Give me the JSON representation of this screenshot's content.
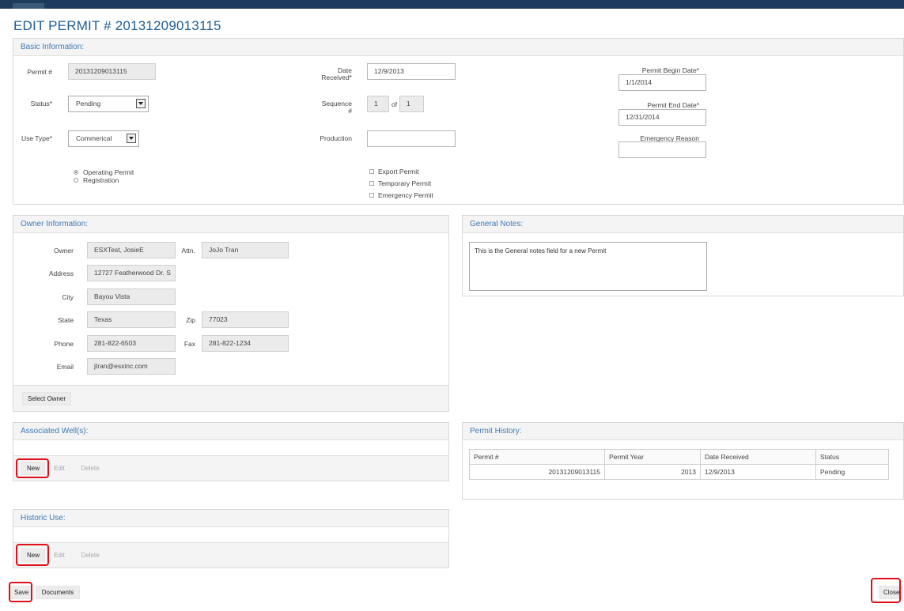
{
  "page": {
    "title": "EDIT PERMIT # 20131209013115"
  },
  "basic": {
    "header": "Basic Information:",
    "permit_label": "Permit #",
    "permit_value": "20131209013115",
    "status_label": "Status*",
    "status_value": "Pending",
    "use_type_label": "Use Type*",
    "use_type_value": "Commerical",
    "date_received_label_1": "Date",
    "date_received_label_2": "Received*",
    "date_received_value": "12/9/2013",
    "sequence_label_1": "Sequence",
    "sequence_label_2": "#",
    "sequence_value": "1",
    "sequence_of": "of",
    "sequence_total": "1",
    "production_label": "Production",
    "production_value": "",
    "begin_label": "Permit Begin Date*",
    "begin_value": "1/1/2014",
    "end_label": "Permit End Date*",
    "end_value": "12/31/2014",
    "emergency_reason_label": "Emergency Reason",
    "emergency_reason_value": "",
    "radio_operating": "Operating Permit",
    "radio_registration": "Registration",
    "chk_export": "Export Permit",
    "chk_temporary": "Temporary Permit",
    "chk_emergency": "Emergency Permit"
  },
  "owner": {
    "header": "Owner Information:",
    "owner_label": "Owner",
    "owner_value": "ESXTest, JosieE",
    "attn_label": "Attn.",
    "attn_value": "JoJo Tran",
    "address_label": "Address",
    "address_value": "12727 Featherwood Dr. S",
    "city_label": "City",
    "city_value": "Bayou Vista",
    "state_label": "State",
    "state_value": "Texas",
    "zip_label": "Zip",
    "zip_value": "77023",
    "phone_label": "Phone",
    "phone_value": "281-822-6503",
    "fax_label": "Fax",
    "fax_value": "281-822-1234",
    "email_label": "Email",
    "email_value": "jtran@esxinc.com",
    "select_owner": "Select Owner"
  },
  "notes": {
    "header": "General Notes:",
    "value": "This is the General notes field for a new Permit"
  },
  "wells": {
    "header": "Associated Well(s):",
    "new": "New",
    "edit": "Edit",
    "delete": "Delete"
  },
  "history": {
    "header": "Permit History:",
    "columns": [
      "Permit #",
      "Permit Year",
      "Date Received",
      "Status"
    ],
    "rows": [
      [
        "20131209013115",
        "2013",
        "12/9/2013",
        "Pending"
      ]
    ]
  },
  "historic": {
    "header": "Historic Use:",
    "new": "New",
    "edit": "Edit",
    "delete": "Delete"
  },
  "actions": {
    "save": "Save",
    "documents": "Documents",
    "close": "Close"
  }
}
